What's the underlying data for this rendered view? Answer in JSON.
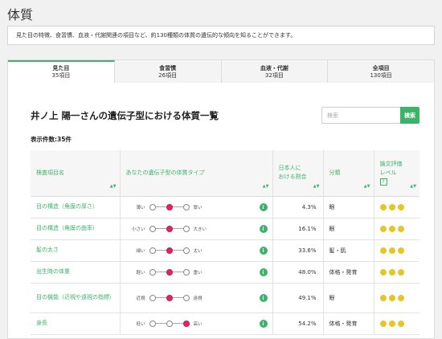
{
  "page": {
    "title": "体質",
    "description": "見た目の特徴、食習慣、血液・代謝関連の項目など、約130種類の体質の遺伝的な傾向を知ることができます。"
  },
  "tabs": [
    {
      "label": "見た目",
      "count": "35項目",
      "active": true
    },
    {
      "label": "食習慣",
      "count": "26項目",
      "active": false
    },
    {
      "label": "血液・代謝",
      "count": "32項目",
      "active": false
    },
    {
      "label": "全項目",
      "count": "130項目",
      "active": false
    }
  ],
  "main": {
    "heading": "井ノ上 陽一さんの遺伝子型における体質一覧",
    "search_placeholder": "検索",
    "search_button": "検索",
    "count_text": "表示件数:35件"
  },
  "table": {
    "headers": {
      "name": "検査項目名",
      "type": "あなたの遺伝子型の体質タイプ",
      "ratio_line1": "日本人に",
      "ratio_line2": "おける割合",
      "category": "分類",
      "eval_line1": "論文評価",
      "eval_line2": "レベル",
      "eval_help": "?"
    },
    "rows": [
      {
        "name": "目の構造（角膜の厚さ）",
        "left": "薄い",
        "right": "厚い",
        "position": 2,
        "ratio": "4.3%",
        "category": "眼",
        "stars": 3
      },
      {
        "name": "目の構造（角膜の曲率）",
        "left": "小さい",
        "right": "大きい",
        "position": 2,
        "ratio": "16.1%",
        "category": "眼",
        "stars": 3
      },
      {
        "name": "髪の太さ",
        "left": "細い",
        "right": "太い",
        "position": 2,
        "ratio": "33.6%",
        "category": "髪・肌",
        "stars": 3
      },
      {
        "name": "出生時の体重",
        "left": "軽い",
        "right": "重い",
        "position": 2,
        "ratio": "48.0%",
        "category": "体格・発育",
        "stars": 3
      },
      {
        "name": "目の機能（近視や遠視の指標）",
        "left": "近視",
        "right": "遠視",
        "position": 2,
        "ratio": "49.1%",
        "category": "眼",
        "stars": 3
      },
      {
        "name": "身長",
        "left": "低い",
        "right": "高い",
        "position": 3,
        "ratio": "54.2%",
        "category": "体格・発育",
        "stars": 3
      }
    ]
  },
  "colors": {
    "accent": "#3db36a",
    "marker": "#e2255a",
    "star": "#e8c526"
  },
  "icons": {
    "info": "info-icon",
    "sort": "sort-icon",
    "help": "help-icon"
  }
}
